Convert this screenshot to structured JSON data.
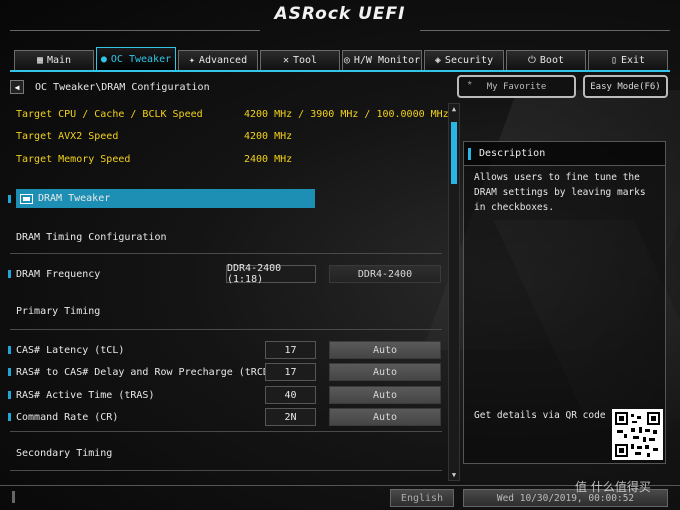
{
  "header": {
    "logo": "ASRock UEFI"
  },
  "tabs": [
    {
      "label": "Main",
      "icon": "square-grid-icon"
    },
    {
      "label": "OC Tweaker",
      "icon": "rocket-icon"
    },
    {
      "label": "Advanced",
      "icon": "star-icon"
    },
    {
      "label": "Tool",
      "icon": "tools-icon"
    },
    {
      "label": "H/W Monitor",
      "icon": "monitor-gauge-icon"
    },
    {
      "label": "Security",
      "icon": "shield-icon"
    },
    {
      "label": "Boot",
      "icon": "power-icon"
    },
    {
      "label": "Exit",
      "icon": "exit-door-icon"
    }
  ],
  "active_tab": "OC Tweaker",
  "breadcrumb": "OC Tweaker\\DRAM Configuration",
  "targets": [
    {
      "label": "Target CPU / Cache / BCLK Speed",
      "value": "4200 MHz / 3900 MHz / 100.0000 MHz"
    },
    {
      "label": "Target AVX2 Speed",
      "value": "4200 MHz"
    },
    {
      "label": "Target Memory Speed",
      "value": "2400 MHz"
    }
  ],
  "dram_tweaker": "DRAM Tweaker",
  "sections": {
    "timing_config": "DRAM Timing Configuration",
    "primary": "Primary Timing",
    "secondary": "Secondary Timing"
  },
  "dram_frequency": {
    "label": "DRAM Frequency",
    "current": "DDR4-2400 (1:18)",
    "setting": "DDR4-2400"
  },
  "primary_timings": [
    {
      "label": "CAS# Latency (tCL)",
      "current": "17",
      "setting": "Auto"
    },
    {
      "label": "RAS# to CAS# Delay and Row Precharge (tRCDtRP)",
      "current": "17",
      "setting": "Auto"
    },
    {
      "label": "RAS# Active Time (tRAS)",
      "current": "40",
      "setting": "Auto"
    },
    {
      "label": "Command Rate (CR)",
      "current": "2N",
      "setting": "Auto"
    }
  ],
  "right": {
    "favorite_label": "My Favorite",
    "easy_mode_label": "Easy Mode(F6)",
    "description_title": "Description",
    "description_text": "Allows users to fine tune the DRAM settings by leaving marks in checkboxes.",
    "qr_text": "Get details via QR code"
  },
  "footer": {
    "language": "English",
    "datetime": "Wed 10/30/2019, 00:00:52",
    "watermark": "值 什么值得买"
  },
  "colors": {
    "accent": "#29b6e6",
    "highlight": "#1d8fb4",
    "target_text": "#f2d21a"
  }
}
